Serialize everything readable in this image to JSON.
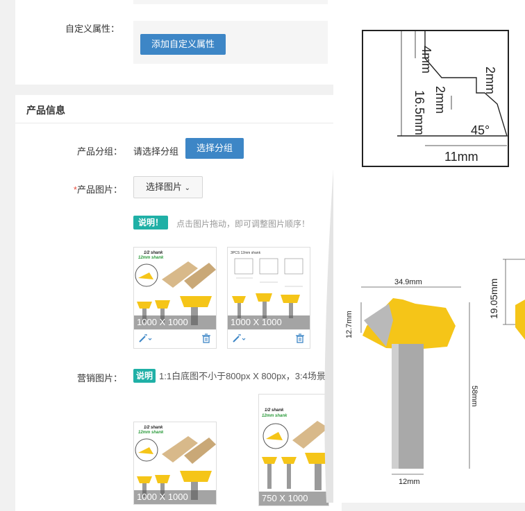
{
  "custom_attr": {
    "label": "自定义属性：",
    "add_button": "添加自定义属性"
  },
  "product_info": {
    "title": "产品信息",
    "group_label": "产品分组：",
    "group_placeholder": "请选择分组",
    "group_button": "选择分组",
    "image_label_required": "*",
    "image_label": "产品图片：",
    "select_image_button": "选择图片",
    "note_badge": "说明！",
    "note_text": "点击图片拖动，即可调整图片顺序！",
    "images": [
      {
        "size": "1000 X 1000",
        "caption": "1/2 shank 12mm shank"
      },
      {
        "size": "1000 X 1000",
        "caption": "3PCS 12mm shank"
      }
    ],
    "marketing_label": "营销图片：",
    "marketing_badge": "说明",
    "marketing_text": "1:1白底图不小于800px X 800px，3:4场景",
    "marketing_images": [
      {
        "size": "1000 X 1000",
        "caption": "1/2 shank 12mm shank"
      },
      {
        "size": "750 X 1000",
        "caption": "1/2 shank 12mm shank"
      }
    ]
  },
  "preview": {
    "dims_top": [
      "4mm",
      "16.5mm",
      "2mm",
      "2mm",
      "45°",
      "11mm"
    ],
    "dims_bottom": [
      "34.9mm",
      "12.7mm",
      "58mm",
      "12mm",
      "19.05mm"
    ]
  },
  "colors": {
    "primary": "#3d86c6",
    "teal": "#1fb0a6",
    "yellow": "#f5c518"
  }
}
